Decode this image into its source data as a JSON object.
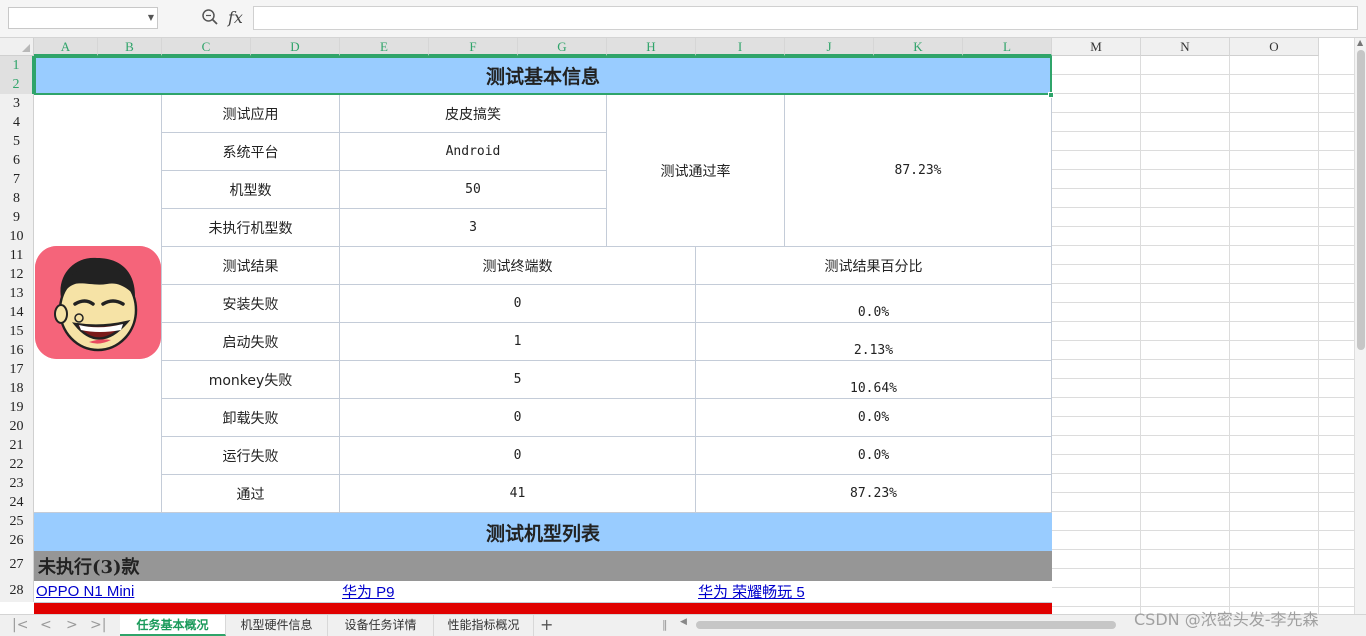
{
  "toolbar": {
    "name_box_value": "",
    "fx_label": "fx",
    "formula_value": ""
  },
  "columns": [
    "A",
    "B",
    "C",
    "D",
    "E",
    "F",
    "G",
    "H",
    "I",
    "J",
    "K",
    "L",
    "M",
    "N",
    "O"
  ],
  "rows": [
    "1",
    "2",
    "3",
    "4",
    "5",
    "6",
    "7",
    "8",
    "9",
    "10",
    "11",
    "12",
    "13",
    "14",
    "15",
    "16",
    "17",
    "18",
    "19",
    "20",
    "21",
    "22",
    "23",
    "24",
    "25",
    "26",
    "27",
    "28"
  ],
  "report": {
    "title": "测试基本信息",
    "info": [
      {
        "label": "测试应用",
        "value": "皮皮搞笑"
      },
      {
        "label": "系统平台",
        "value": "Android"
      },
      {
        "label": "机型数",
        "value": "50"
      },
      {
        "label": "未执行机型数",
        "value": "3"
      }
    ],
    "pass_rate_label": "测试通过率",
    "pass_rate_value": "87.23%",
    "results_header": {
      "col1": "测试结果",
      "col2": "测试终端数",
      "col3": "测试结果百分比"
    },
    "results": [
      {
        "label": "安装失败",
        "count": "0",
        "percent": "0.0%"
      },
      {
        "label": "启动失败",
        "count": "1",
        "percent": "2.13%"
      },
      {
        "label": "monkey失败",
        "count": "5",
        "percent": "10.64%"
      },
      {
        "label": "卸载失败",
        "count": "0",
        "percent": "0.0%"
      },
      {
        "label": "运行失败",
        "count": "0",
        "percent": "0.0%"
      },
      {
        "label": "通过",
        "count": "41",
        "percent": "87.23%"
      }
    ],
    "models_title": "测试机型列表",
    "not_executed_label": "未执行(3)款",
    "not_executed_models": [
      "OPPO N1 Mini",
      "华为 P9",
      "华为 荣耀畅玩 5"
    ]
  },
  "sheet_tabs": [
    {
      "label": "任务基本概况",
      "active": true
    },
    {
      "label": "机型硬件信息",
      "active": false
    },
    {
      "label": "设备任务详情",
      "active": false
    },
    {
      "label": "性能指标概况",
      "active": false
    }
  ],
  "add_sheet_label": "+",
  "watermark": "CSDN @浓密头发-李先森",
  "colors": {
    "header_blue": "#99ccff",
    "section_gray": "#969696",
    "alert_red": "#e00000",
    "selection_green": "#2fa46a",
    "link_blue": "#0000cc",
    "logo_pink": "#f5647a"
  }
}
